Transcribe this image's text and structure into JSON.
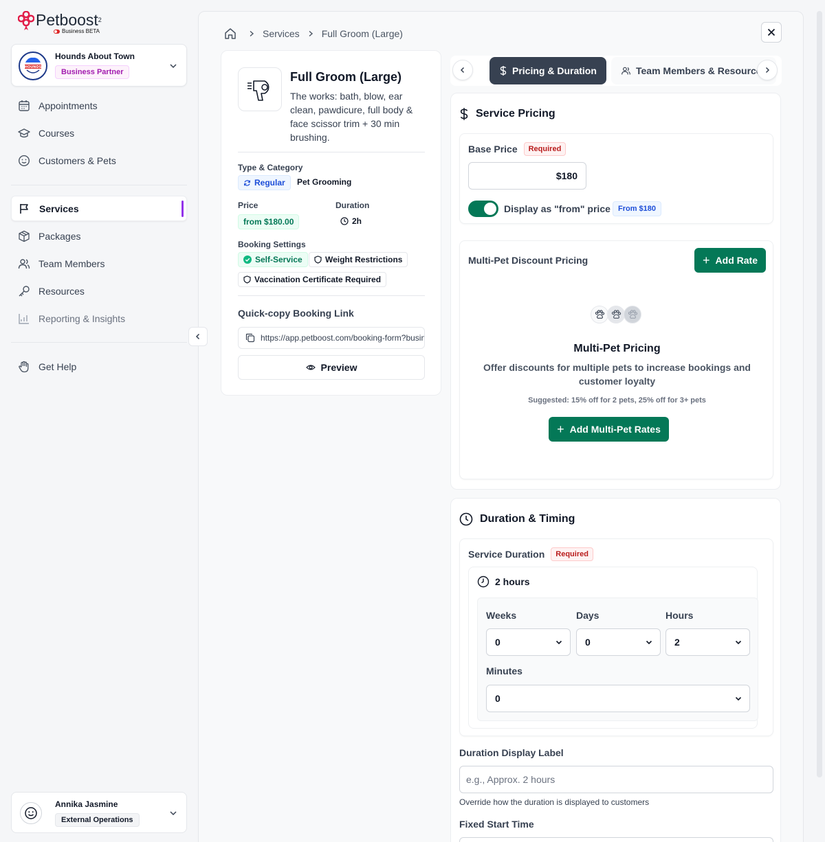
{
  "brand": {
    "name": "Petboost",
    "sup": "2",
    "tagline": "Business BETA",
    "accent": "#dc2626"
  },
  "business": {
    "name": "Hounds About Town",
    "badge": "Business Partner",
    "avatar_text": "HOUNDS"
  },
  "nav": {
    "items": [
      {
        "label": "Appointments",
        "icon": "calendar-icon"
      },
      {
        "label": "Courses",
        "icon": "graduation-cap-icon"
      },
      {
        "label": "Customers & Pets",
        "icon": "smile-icon"
      },
      {
        "label": "Services",
        "icon": "flag-icon",
        "active": true
      },
      {
        "label": "Packages",
        "icon": "package-icon"
      },
      {
        "label": "Team Members",
        "icon": "users-icon"
      },
      {
        "label": "Resources",
        "icon": "key-icon"
      },
      {
        "label": "Reporting & Insights",
        "icon": "chart-icon"
      },
      {
        "label": "Get Help",
        "icon": "help-hand-icon"
      }
    ],
    "active_color": "#9333ea"
  },
  "user": {
    "name": "Annika Jasmine",
    "role": "External Operations"
  },
  "breadcrumb": {
    "items": [
      "Services",
      "Full Groom (Large)"
    ]
  },
  "service": {
    "title": "Full Groom (Large)",
    "description": "The works: bath, blow, ear clean, pawdicure, full body & face scissor trim + 30 min brushing.",
    "type_category_label": "Type & Category",
    "type": "Regular",
    "category": "Pet Grooming",
    "price_label": "Price",
    "price": "from $180.00",
    "duration_label": "Duration",
    "duration": "2h",
    "booking_settings_label": "Booking Settings",
    "booking_settings": [
      "Self-Service",
      "Weight Restrictions",
      "Vaccination Certificate Required"
    ],
    "link_label": "Quick-copy Booking Link",
    "link": "https://app.petboost.com/booking-form?business=hounds",
    "preview_label": "Preview"
  },
  "tabs": [
    {
      "label": "Pricing & Duration",
      "active": true
    },
    {
      "label": "Team Members & Resources",
      "active": false
    }
  ],
  "pricing": {
    "title": "Service Pricing",
    "base_price_label": "Base Price",
    "required": "Required",
    "base_price": "$180",
    "display_from_label": "Display as \"from\" price",
    "display_from_on": true,
    "from_badge": "From $180"
  },
  "multi_pet": {
    "title": "Multi-Pet Discount Pricing",
    "add_rate": "Add Rate",
    "empty_title": "Multi-Pet Pricing",
    "empty_desc": "Offer discounts for multiple pets to increase bookings and customer loyalty",
    "suggestion": "Suggested: 15% off for 2 pets, 25% off for 3+ pets",
    "cta": "Add Multi-Pet Rates"
  },
  "duration": {
    "title": "Duration & Timing",
    "service_duration_label": "Service Duration",
    "required": "Required",
    "summary": "2 hours",
    "weeks_label": "Weeks",
    "weeks": "0",
    "days_label": "Days",
    "days": "0",
    "hours_label": "Hours",
    "hours": "2",
    "minutes_label": "Minutes",
    "minutes": "0",
    "display_label": "Duration Display Label",
    "display_placeholder": "e.g., Approx. 2 hours",
    "display_help": "Override how the duration is displayed to customers",
    "fixed_start_label": "Fixed Start Time"
  },
  "colors": {
    "primary_green": "#047857",
    "tab_active": "#374151"
  }
}
